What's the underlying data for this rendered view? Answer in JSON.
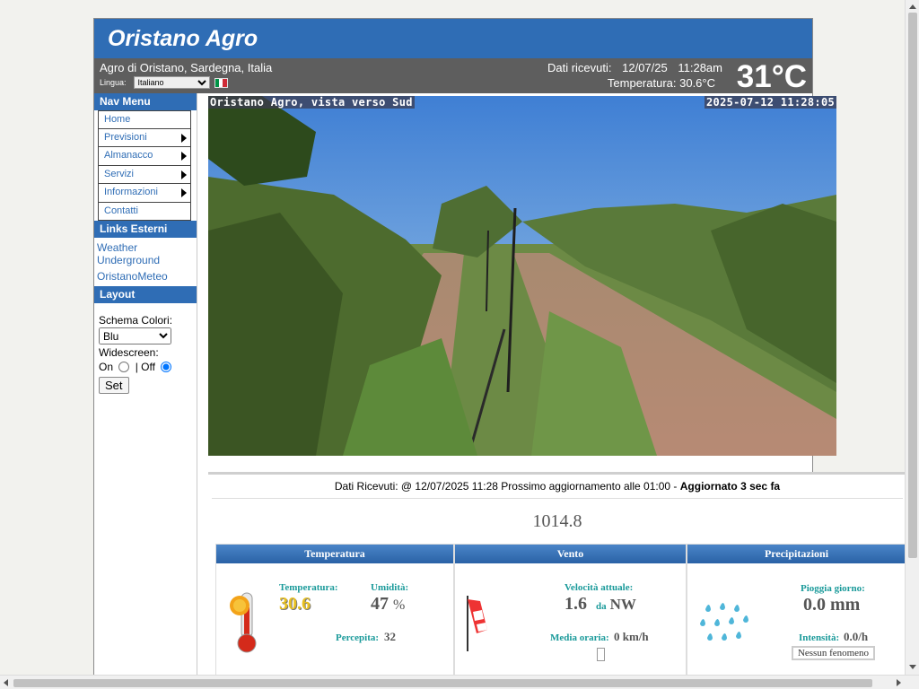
{
  "header": {
    "title": "Oristano Agro"
  },
  "info_bar": {
    "location": "Agro di Oristano, Sardegna, Italia",
    "language_label": "Lingua:",
    "language_selected": "Italiano",
    "received_label": "Dati ricevuti:",
    "received_date": "12/07/25",
    "received_time": "11:28am",
    "temperature_line": "Temperatura: 30.6°C",
    "big_temperature": "31°C"
  },
  "sidebar": {
    "nav_title": "Nav Menu",
    "nav_items": [
      {
        "label": "Home",
        "submenu": false
      },
      {
        "label": "Previsioni",
        "submenu": true
      },
      {
        "label": "Almanacco",
        "submenu": true
      },
      {
        "label": "Servizi",
        "submenu": true
      },
      {
        "label": "Informazioni",
        "submenu": true
      },
      {
        "label": "Contatti",
        "submenu": false
      }
    ],
    "links_title": "Links Esterni",
    "links": [
      "Weather Underground",
      "OristanoMeteo"
    ],
    "layout_title": "Layout",
    "color_scheme_label": "Schema Colori:",
    "color_scheme_value": "Blu",
    "widescreen_label": "Widescreen:",
    "on_label": "On",
    "off_label": "| Off",
    "widescreen_selected": "off",
    "set_label": "Set"
  },
  "webcam": {
    "title_overlay": "Oristano Agro, vista verso Sud",
    "timestamp_overlay": "2025-07-12 11:28:05"
  },
  "status": {
    "text": "Dati Ricevuti: @ 12/07/2025 11:28 Prossimo aggiornamento alle 01:00",
    "updated": "Aggiornato 3 sec fa"
  },
  "pressure": "1014.8",
  "cards": {
    "temperature": {
      "title": "Temperatura",
      "temp_label": "Temperatura:",
      "temp_value": "30.6",
      "humidity_label": "Umidità:",
      "humidity_value": "47",
      "humidity_unit": "%",
      "feels_label": "Percepita:",
      "feels_value": "32"
    },
    "wind": {
      "title": "Vento",
      "speed_label": "Velocità attuale:",
      "speed_value": "1.6",
      "from_label": "da",
      "direction": "NW",
      "avg_label": "Media oraria:",
      "avg_value": "0 km/h"
    },
    "rain": {
      "title": "Precipitazioni",
      "day_label": "Pioggia giorno:",
      "day_value": "0.0 mm",
      "intensity_label": "Intensità:",
      "intensity_value": "0.0/h",
      "phenomenon": "Nessun fenomeno"
    }
  },
  "colors": {
    "brand_blue": "#2f6db5",
    "info_bar_gray": "#5e5e5e",
    "label_teal": "#1a9a9a"
  }
}
